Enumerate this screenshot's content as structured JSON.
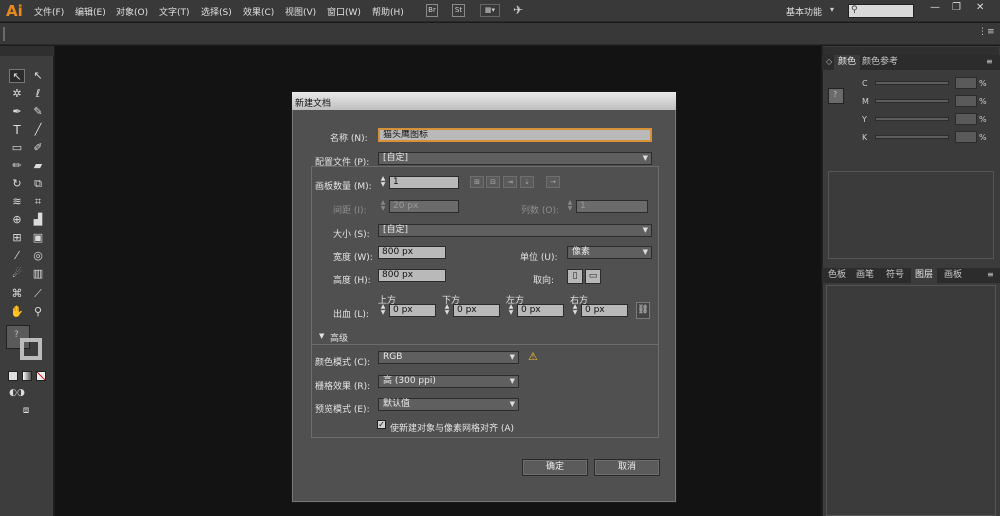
{
  "app": {
    "logo": "Ai"
  },
  "menu": [
    "文件(F)",
    "编辑(E)",
    "对象(O)",
    "文字(T)",
    "选择(S)",
    "效果(C)",
    "视图(V)",
    "窗口(W)",
    "帮助(H)"
  ],
  "menubar": {
    "doc_icon": "Br",
    "zoom_badge": "St",
    "workspace": "基本功能",
    "workspace_arrow": "▾"
  },
  "window_controls": {
    "minimize": "—",
    "restore": "❐",
    "close": "✕"
  },
  "toolbar_icons": [
    "selection-tool-icon",
    "direct-selection-tool-icon",
    "magic-wand-tool-icon",
    "lasso-tool-icon",
    "pen-tool-icon",
    "curvature-tool-icon",
    "type-tool-icon",
    "line-tool-icon",
    "rectangle-tool-icon",
    "paintbrush-tool-icon",
    "pencil-tool-icon",
    "eraser-tool-icon",
    "rotate-tool-icon",
    "scale-tool-icon",
    "width-tool-icon",
    "free-transform-tool-icon",
    "shape-builder-tool-icon",
    "perspective-grid-tool-icon",
    "mesh-tool-icon",
    "gradient-tool-icon",
    "eyedropper-tool-icon",
    "blend-tool-icon",
    "symbol-sprayer-tool-icon",
    "graph-tool-icon",
    "artboard-tool-icon",
    "slice-tool-icon",
    "hand-tool-icon",
    "zoom-tool-icon"
  ],
  "color_panel": {
    "tabs": [
      "颜色",
      "颜色参考"
    ],
    "channels": [
      {
        "label": "C",
        "value": "",
        "unit": "%"
      },
      {
        "label": "M",
        "value": "",
        "unit": "%"
      },
      {
        "label": "Y",
        "value": "",
        "unit": "%"
      },
      {
        "label": "K",
        "value": "",
        "unit": "%"
      }
    ]
  },
  "layers_panel": {
    "tabs": [
      "色板",
      "画笔",
      "符号",
      "图层",
      "画板"
    ],
    "active_tab": "图层"
  },
  "dialog": {
    "title": "新建文档",
    "name_label": "名称 (N):",
    "name_value": "猫头鹰图标",
    "profile_label": "配置文件 (P):",
    "profile_value": "[自定]",
    "artboards_label": "画板数量 (M):",
    "artboards_value": "1",
    "spacing_label": "间距 (I):",
    "spacing_value": "20 px",
    "columns_label": "列数 (O):",
    "columns_value": "1",
    "size_label": "大小 (S):",
    "size_value": "[自定]",
    "width_label": "宽度 (W):",
    "width_value": "800 px",
    "units_label": "单位 (U):",
    "units_value": "像素",
    "height_label": "高度 (H):",
    "height_value": "800 px",
    "orientation_label": "取向:",
    "bleed_label": "出血 (L):",
    "bleed": [
      {
        "label": "上方",
        "value": "0 px"
      },
      {
        "label": "下方",
        "value": "0 px"
      },
      {
        "label": "左方",
        "value": "0 px"
      },
      {
        "label": "右方",
        "value": "0 px"
      }
    ],
    "advanced_label": "高级",
    "color_mode_label": "颜色模式 (C):",
    "color_mode_value": "RGB",
    "raster_label": "栅格效果 (R):",
    "raster_value": "高 (300 ppi)",
    "preview_label": "预览模式 (E):",
    "preview_value": "默认值",
    "align_label": "使新建对象与像素网格对齐 (A)",
    "align_checked": true,
    "ok_label": "确定",
    "cancel_label": "取消"
  },
  "colors": {
    "accent": "#e8891c",
    "canvas": "#131313",
    "panel": "#3b3b3b",
    "warning": "#f2c12e"
  }
}
